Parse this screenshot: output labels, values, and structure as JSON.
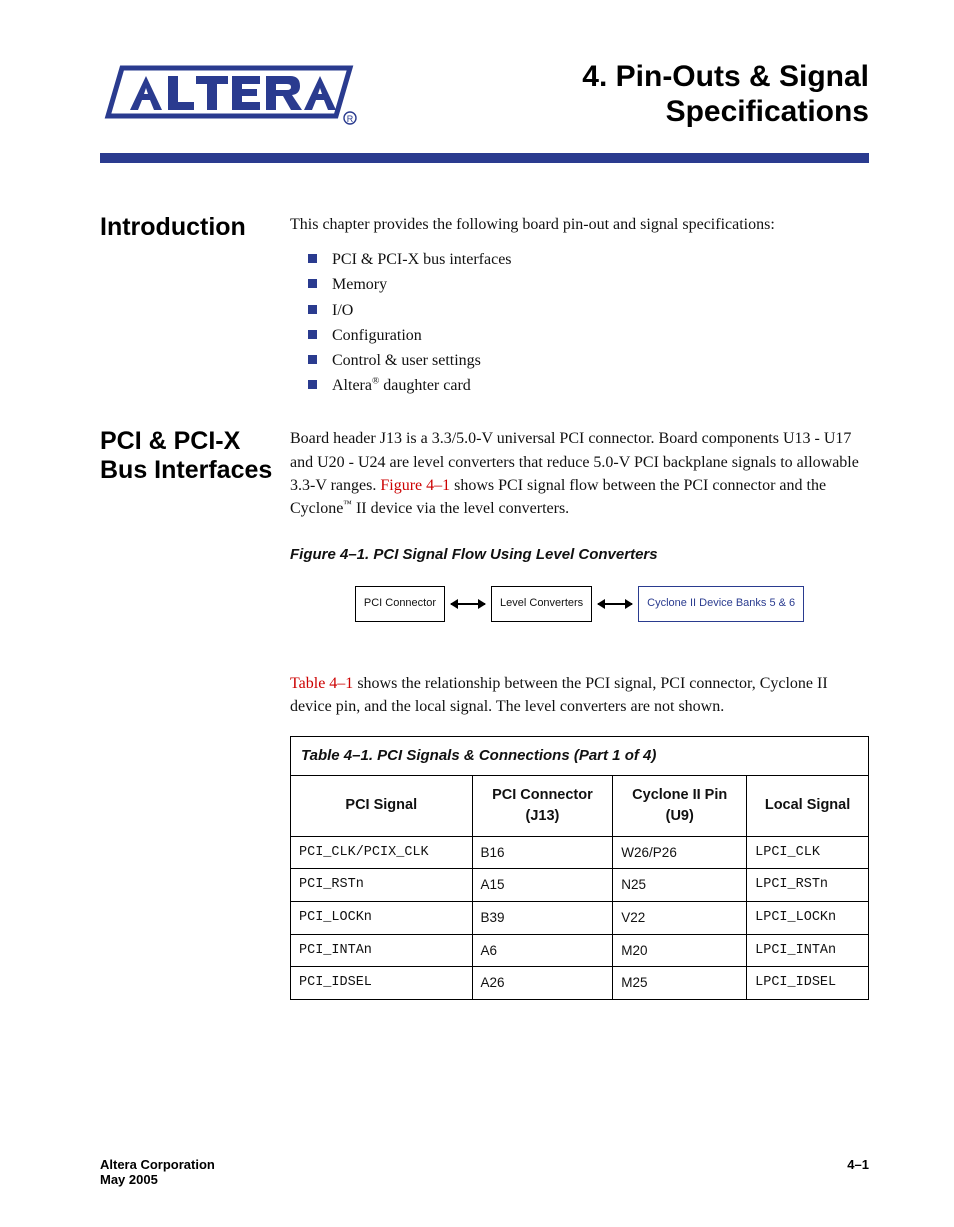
{
  "header": {
    "chapter_title_line1": "4.  Pin-Outs & Signal",
    "chapter_title_line2": "Specifications"
  },
  "intro": {
    "heading": "Introduction",
    "para": "This chapter provides the following board pin-out and signal specifications:",
    "bullets": [
      "PCI & PCI-X bus interfaces",
      "Memory",
      "I/O",
      "Configuration",
      "Control & user settings",
      "Altera® daughter card"
    ]
  },
  "pci": {
    "heading": "PCI & PCI-X Bus Interfaces",
    "para_before_link": "Board header J13 is a 3.3/5.0-V universal PCI connector. Board components U13 - U17 and U20 - U24 are level converters that reduce 5.0-V PCI backplane signals to allowable 3.3-V ranges. ",
    "link_fig": "Figure 4–1",
    "para_after_link": " shows PCI signal flow between the PCI connector and the Cyclone™ II device via the level converters.",
    "figure_caption": "Figure 4–1. PCI Signal Flow Using Level Converters",
    "flow": {
      "box1": "PCI Connector",
      "box2": "Level Converters",
      "box3": "Cyclone II Device Banks 5 & 6"
    },
    "para2_link": "Table 4–1",
    "para2_rest": " shows the relationship between the PCI signal, PCI connector, Cyclone II device pin, and the local signal. The level converters are not shown."
  },
  "table": {
    "caption": "Table 4–1. PCI Signals & Connections   (Part 1 of 4)",
    "headers": [
      "PCI Signal",
      "PCI Connector (J13)",
      "Cyclone II Pin (U9)",
      "Local Signal"
    ],
    "rows": [
      [
        "PCI_CLK/PCIX_CLK",
        "B16",
        "W26/P26",
        "LPCI_CLK"
      ],
      [
        "PCI_RSTn",
        "A15",
        "N25",
        "LPCI_RSTn"
      ],
      [
        "PCI_LOCKn",
        "B39",
        "V22",
        "LPCI_LOCKn"
      ],
      [
        "PCI_INTAn",
        "A6",
        "M20",
        "LPCI_INTAn"
      ],
      [
        "PCI_IDSEL",
        "A26",
        "M25",
        "LPCI_IDSEL"
      ]
    ]
  },
  "footer": {
    "left_line1": "Altera Corporation",
    "left_line2": "May 2005",
    "right": "4–1"
  }
}
